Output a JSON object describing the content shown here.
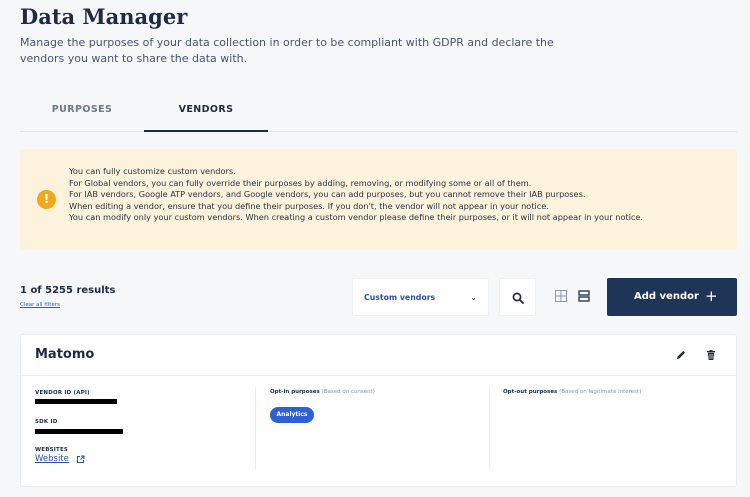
{
  "header": {
    "title": "Data Manager",
    "description": "Manage the purposes of your data collection in order to be compliant with GDPR and declare the vendors you want to share the data with."
  },
  "tabs": [
    {
      "label": "PURPOSES",
      "active": false
    },
    {
      "label": "VENDORS",
      "active": true
    }
  ],
  "notice": {
    "lines": [
      "You can fully customize custom vendors.",
      "For Global vendors, you can fully override their purposes by adding, removing, or modifying some or all of them.",
      "For IAB vendors, Google ATP vendors, and Google vendors, you can add purposes, but you cannot remove their IAB purposes.",
      "When editing a vendor, ensure that you define their purposes. If you don't, the vendor will not appear in your notice.",
      "You can modify only your custom vendors. When creating a custom vendor please define their purposes, or it will not appear in your notice."
    ]
  },
  "toolbar": {
    "results": "1 of 5255 results",
    "clear_filters": "Clear all filters",
    "filter_value": "Custom vendors",
    "add_label": "Add vendor",
    "add_icon": "+"
  },
  "vendor": {
    "name": "Matomo",
    "vendor_id_label": "VENDOR ID (API)",
    "sdk_id_label": "SDK ID",
    "websites_label": "WEBSITES",
    "website_link": "Website",
    "optin_title": "Opt-in purposes",
    "optin_note": "(Based on consent)",
    "optin_tags": [
      "Analytics"
    ],
    "optout_title": "Opt-out purposes",
    "optout_note": "(Based on legitimate interest)"
  },
  "colors": {
    "primary_button": "#1e3557",
    "notice_bg": "#fdf3dc",
    "warning_icon": "#f0a81d",
    "tag": "#2d5fd8",
    "link": "#2b4fa8"
  },
  "icons": [
    "warning-icon",
    "chevron-down-icon",
    "search-icon",
    "grid-view-icon",
    "list-view-icon",
    "plus-icon",
    "edit-icon",
    "trash-icon",
    "external-link-icon"
  ]
}
